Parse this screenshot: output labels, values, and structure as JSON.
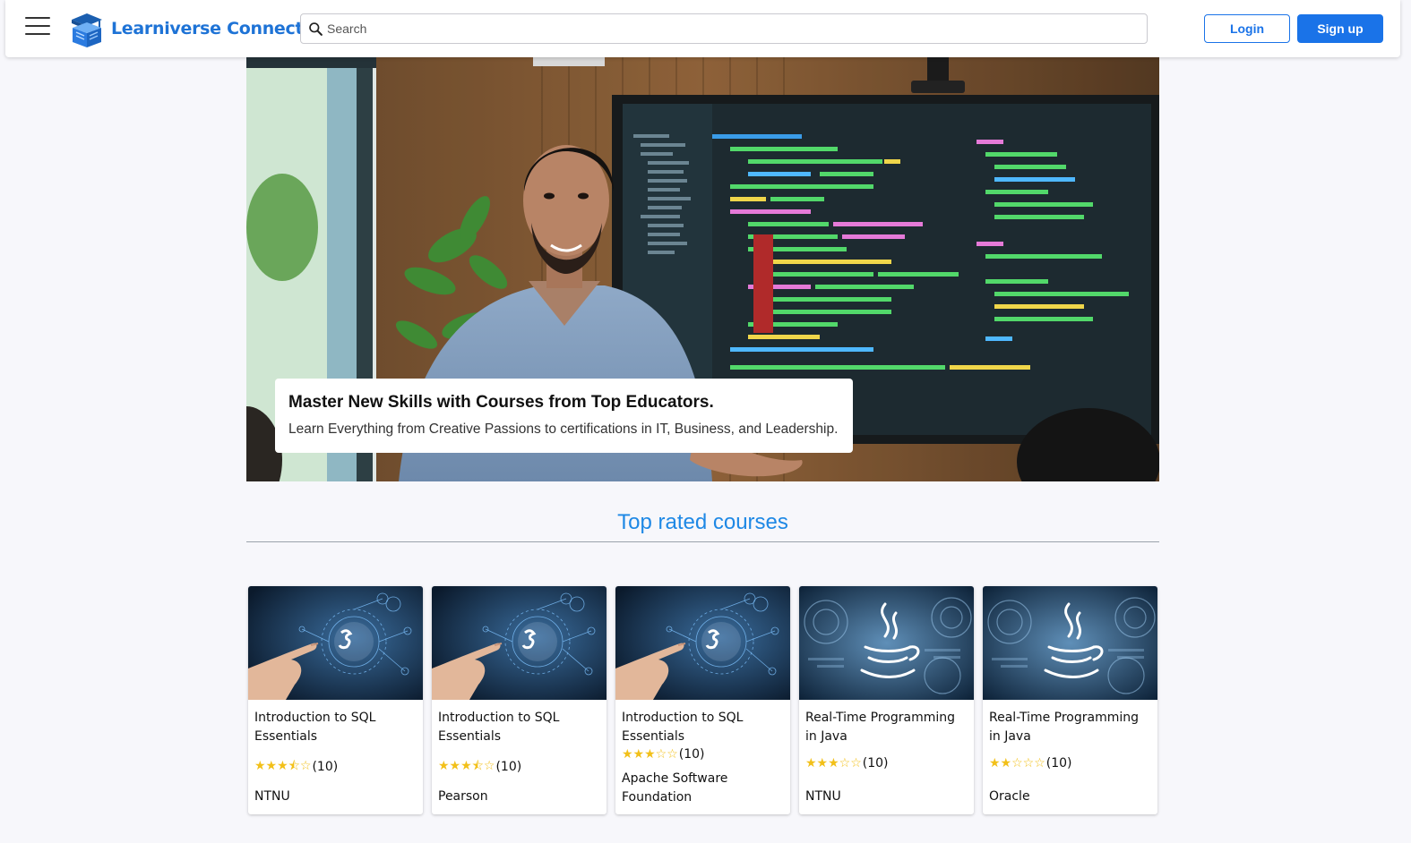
{
  "header": {
    "brand": "Learniverse Connect",
    "search_placeholder": "Search",
    "login_label": "Login",
    "signup_label": "Sign up",
    "accent_color": "#1a73e8"
  },
  "hero": {
    "title": "Master New Skills with Courses from Top Educators.",
    "subtitle": "Learn Everything from Creative Passions to certifications in IT, Business, and Leadership."
  },
  "section": {
    "title": "Top rated courses"
  },
  "courses": [
    {
      "title": "Introduction to SQL Essentials",
      "stars": "★★★⯪☆",
      "rating": 3.5,
      "reviews": "(10)",
      "provider": "NTNU",
      "image": "sql-thumbnail"
    },
    {
      "title": "Introduction to SQL Essentials",
      "stars": "★★★⯪☆",
      "rating": 3.5,
      "reviews": "(10)",
      "provider": "Pearson",
      "image": "sql-thumbnail"
    },
    {
      "title": "Introduction to SQL Essentials",
      "stars": "★★★☆☆",
      "rating": 3,
      "reviews": "(10)",
      "provider": "Apache Software Foundation",
      "image": "sql-thumbnail"
    },
    {
      "title": "Real-Time Programming in Java",
      "stars": "★★★☆☆",
      "rating": 3,
      "reviews": "(10)",
      "provider": "NTNU",
      "image": "java-thumbnail"
    },
    {
      "title": "Real-Time Programming in Java",
      "stars": "★★☆☆☆",
      "rating": 2,
      "reviews": "(10)",
      "provider": "Oracle",
      "image": "java-thumbnail"
    }
  ]
}
